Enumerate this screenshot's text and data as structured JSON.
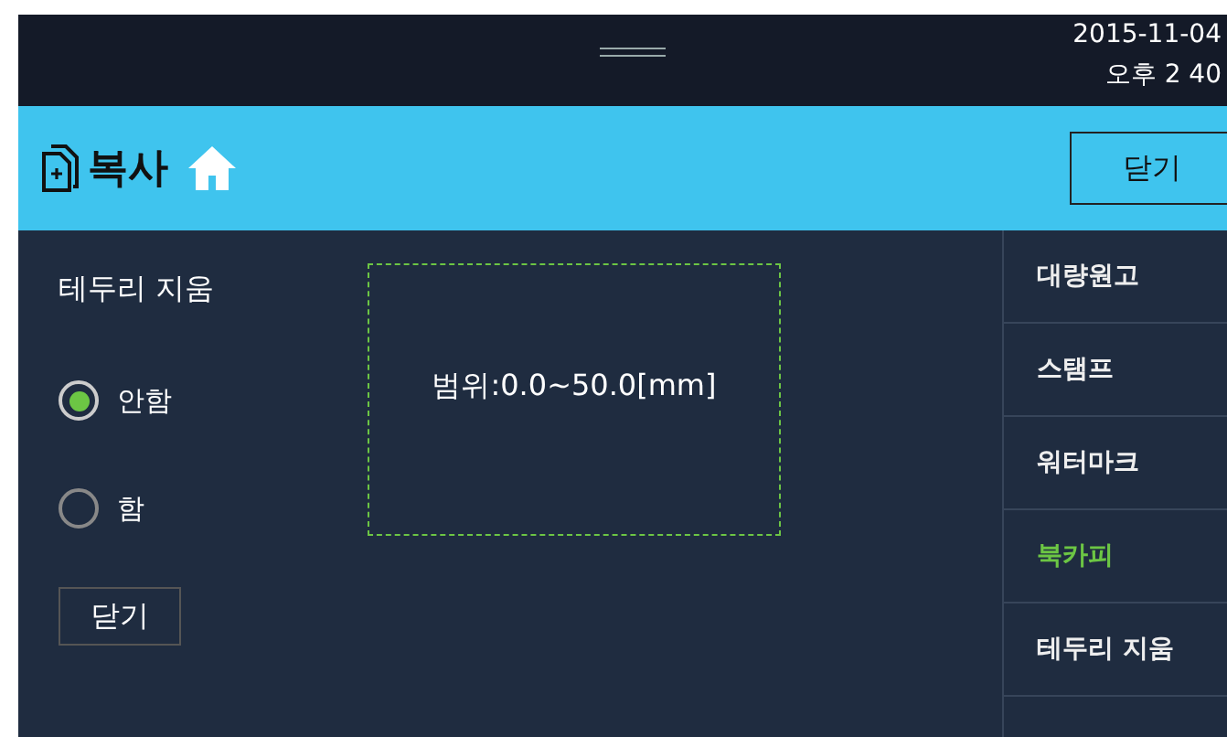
{
  "status_bar": {
    "date": "2015-11-04",
    "time": "오후 2 40"
  },
  "header": {
    "title": "복사",
    "close_button": "닫기"
  },
  "panel": {
    "title": "테두리 지움",
    "options": [
      {
        "label": "안함",
        "selected": true
      },
      {
        "label": "함",
        "selected": false
      }
    ],
    "close_button": "닫기",
    "range_text": "범위:0.0~50.0[mm]"
  },
  "sidebar": {
    "items": [
      {
        "label": "대량원고",
        "selected": false
      },
      {
        "label": "스탬프",
        "selected": false
      },
      {
        "label": "워터마크",
        "selected": false
      },
      {
        "label": "북카피",
        "selected": true
      },
      {
        "label": "테두리 지움",
        "selected": false
      }
    ]
  }
}
